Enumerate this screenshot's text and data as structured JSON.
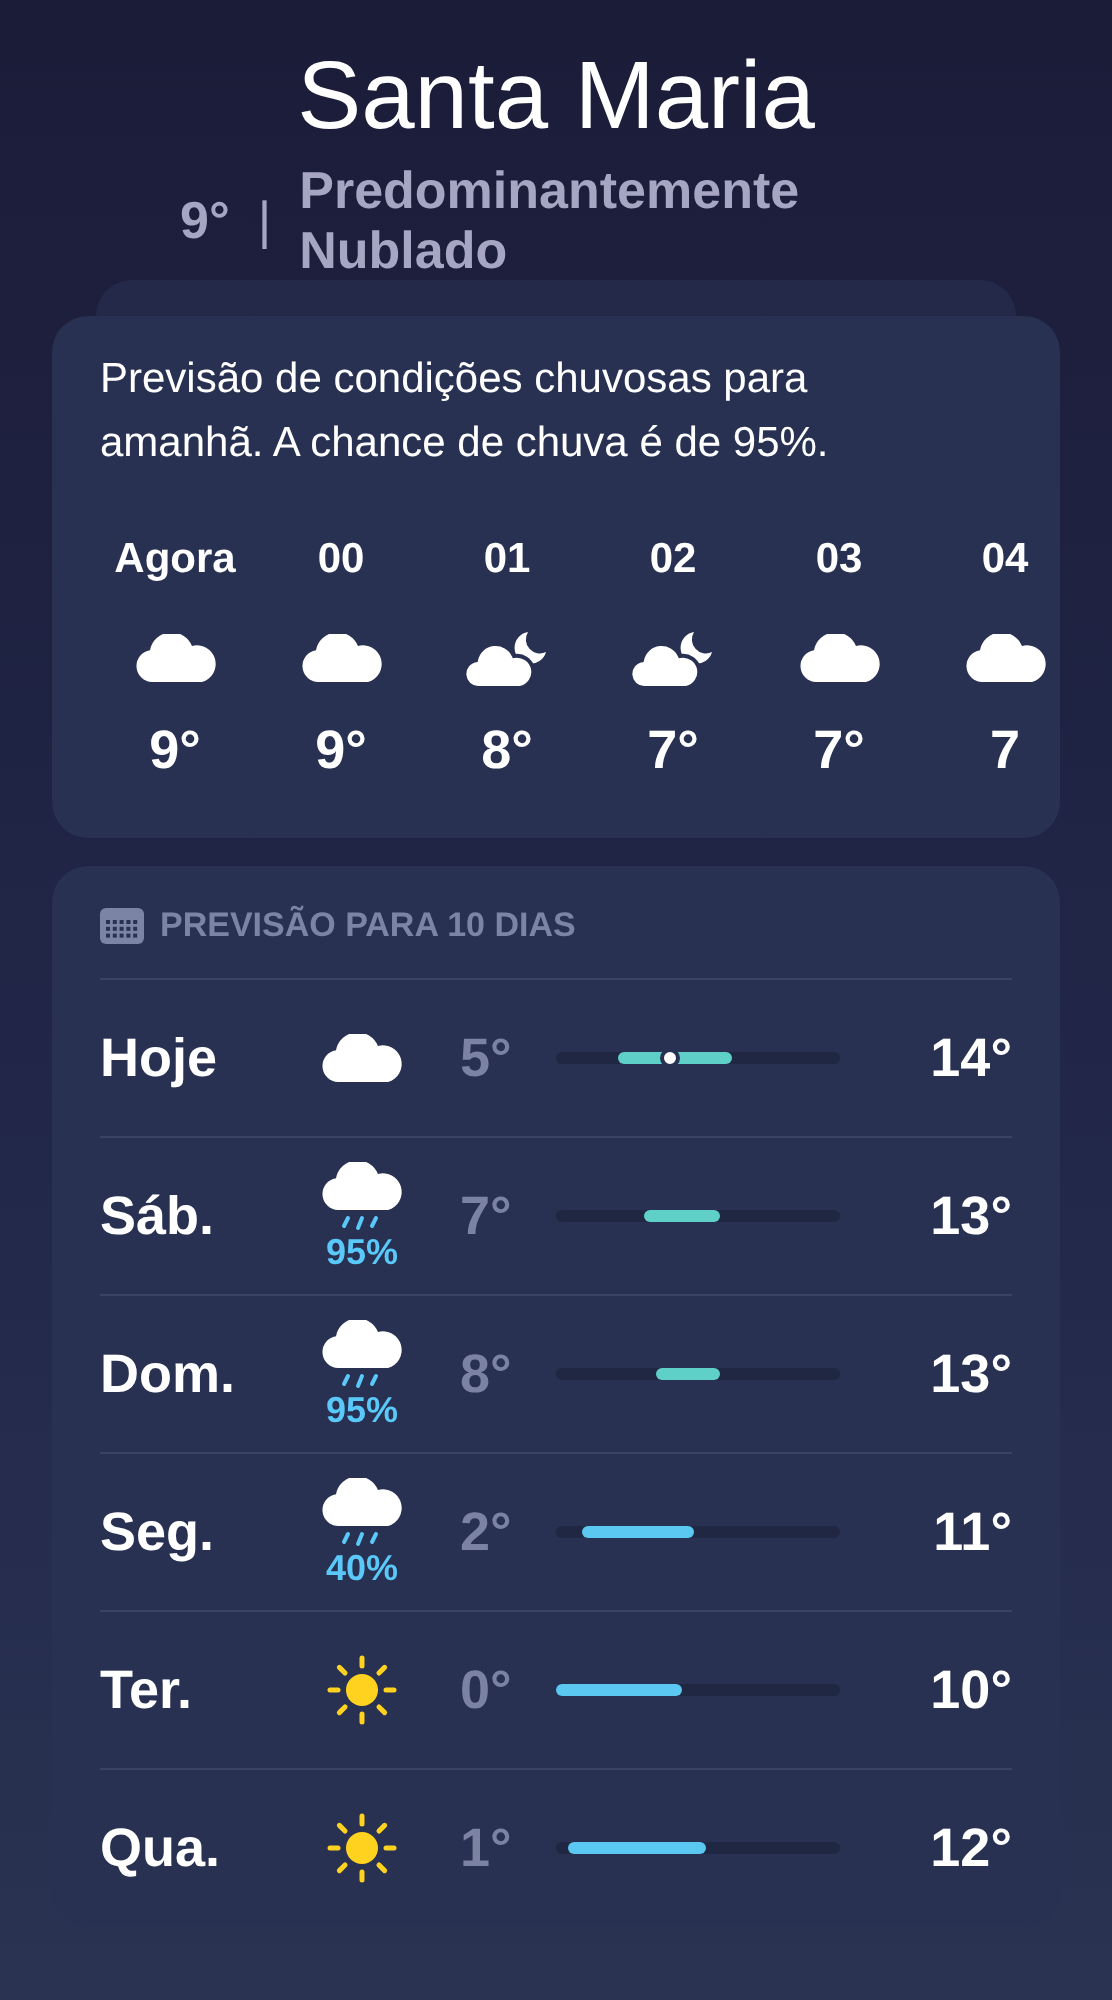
{
  "location": {
    "city": "Santa Maria",
    "temperature": "9°",
    "separator": "|",
    "condition": "Predominantemente Nublado"
  },
  "hourly": {
    "summary": "Previsão de condições chuvosas para amanhã. A chance de chuva é de 95%.",
    "hours": [
      {
        "time": "Agora",
        "kind": "cloud",
        "temp": "9°"
      },
      {
        "time": "00",
        "kind": "cloud",
        "temp": "9°"
      },
      {
        "time": "01",
        "kind": "cloud-moon",
        "temp": "8°"
      },
      {
        "time": "02",
        "kind": "cloud-moon",
        "temp": "7°"
      },
      {
        "time": "03",
        "kind": "cloud",
        "temp": "7°"
      },
      {
        "time": "04",
        "kind": "cloud",
        "temp": "7"
      }
    ]
  },
  "daily": {
    "title": "PREVISÃO PARA 10 DIAS",
    "days": [
      {
        "day": "Hoje",
        "kind": "cloud",
        "low": "5°",
        "high": "14°",
        "color": "#5fd0c8",
        "now_marker": true
      },
      {
        "day": "Sáb.",
        "kind": "rain",
        "precip": "95%",
        "low": "7°",
        "high": "13°",
        "color": "#5fd0c8",
        "now_marker": false
      },
      {
        "day": "Dom.",
        "kind": "rain",
        "precip": "95%",
        "low": "8°",
        "high": "13°",
        "color": "#5fd0c8",
        "now_marker": false
      },
      {
        "day": "Seg.",
        "kind": "rain",
        "precip": "40%",
        "low": "2°",
        "high": "11°",
        "color": "#5ac8f0",
        "now_marker": false
      },
      {
        "day": "Ter.",
        "kind": "sun",
        "low": "0°",
        "high": "10°",
        "color": "#5ac8f0",
        "now_marker": false
      },
      {
        "day": "Qua.",
        "kind": "sun",
        "low": "1°",
        "high": "12°",
        "color": "#5ac8f0",
        "now_marker": false
      }
    ]
  }
}
